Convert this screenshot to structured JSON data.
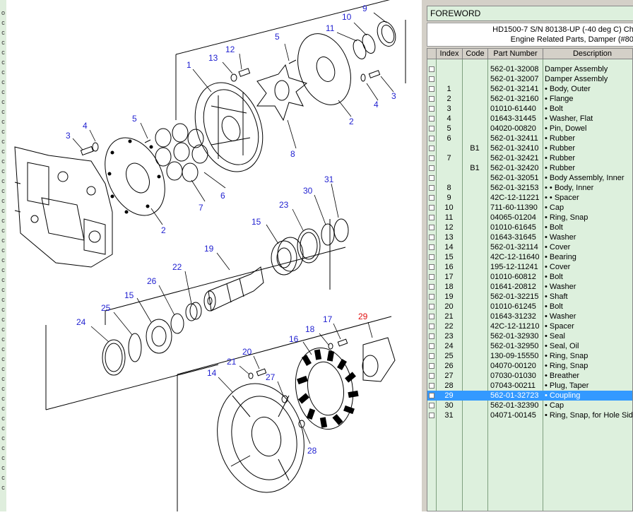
{
  "left_strip_letters": [
    "o",
    "c",
    "c",
    "c",
    "c",
    "c",
    "c",
    "c",
    "c",
    "c",
    "c",
    "c",
    "c",
    "c",
    "c",
    "c",
    "c",
    "c",
    "c",
    "c",
    "c",
    "c",
    "c",
    "c",
    "c",
    "c",
    "c",
    "c",
    "c",
    "c",
    "c",
    "c",
    "c",
    "c",
    "c",
    "c",
    "c",
    "c",
    "c",
    "c",
    "c",
    "c",
    "c",
    "c",
    "c",
    "c",
    "c",
    "c",
    "c"
  ],
  "doc_title": "FOREWORD",
  "header": {
    "line1": "HD1500-7 S/N 80138-UP (-40 deg C) Cha",
    "line2": "Engine Related Parts, Damper (#801"
  },
  "columns": {
    "index": "Index",
    "code": "Code",
    "part_number": "Part Number",
    "description": "Description"
  },
  "rows": [
    {
      "index": "",
      "code": "",
      "part": "562-01-32008",
      "desc": "Damper Assembly"
    },
    {
      "index": "",
      "code": "",
      "part": "562-01-32007",
      "desc": "Damper Assembly"
    },
    {
      "index": "1",
      "code": "",
      "part": "562-01-32141",
      "desc": "• Body, Outer"
    },
    {
      "index": "2",
      "code": "",
      "part": "562-01-32160",
      "desc": "• Flange"
    },
    {
      "index": "3",
      "code": "",
      "part": "01010-61440",
      "desc": "• Bolt"
    },
    {
      "index": "4",
      "code": "",
      "part": "01643-31445",
      "desc": "• Washer, Flat"
    },
    {
      "index": "5",
      "code": "",
      "part": "04020-00820",
      "desc": "• Pin, Dowel"
    },
    {
      "index": "6",
      "code": "",
      "part": "562-01-32411",
      "desc": "• Rubber"
    },
    {
      "index": "",
      "code": "B1",
      "part": "562-01-32410",
      "desc": "• Rubber"
    },
    {
      "index": "7",
      "code": "",
      "part": "562-01-32421",
      "desc": "• Rubber"
    },
    {
      "index": "",
      "code": "B1",
      "part": "562-01-32420",
      "desc": "• Rubber"
    },
    {
      "index": "",
      "code": "",
      "part": "562-01-32051",
      "desc": "• Body Assembly, Inner"
    },
    {
      "index": "8",
      "code": "",
      "part": "562-01-32153",
      "desc": "• • Body, Inner"
    },
    {
      "index": "9",
      "code": "",
      "part": "42C-12-11221",
      "desc": "• • Spacer"
    },
    {
      "index": "10",
      "code": "",
      "part": "711-60-11390",
      "desc": "• Cap"
    },
    {
      "index": "11",
      "code": "",
      "part": "04065-01204",
      "desc": "• Ring, Snap"
    },
    {
      "index": "12",
      "code": "",
      "part": "01010-61645",
      "desc": "• Bolt"
    },
    {
      "index": "13",
      "code": "",
      "part": "01643-31645",
      "desc": "• Washer"
    },
    {
      "index": "14",
      "code": "",
      "part": "562-01-32114",
      "desc": "• Cover"
    },
    {
      "index": "15",
      "code": "",
      "part": "42C-12-11640",
      "desc": "• Bearing"
    },
    {
      "index": "16",
      "code": "",
      "part": "195-12-11241",
      "desc": "• Cover"
    },
    {
      "index": "17",
      "code": "",
      "part": "01010-60812",
      "desc": "• Bolt"
    },
    {
      "index": "18",
      "code": "",
      "part": "01641-20812",
      "desc": "• Washer"
    },
    {
      "index": "19",
      "code": "",
      "part": "562-01-32215",
      "desc": "• Shaft"
    },
    {
      "index": "20",
      "code": "",
      "part": "01010-61245",
      "desc": "• Bolt"
    },
    {
      "index": "21",
      "code": "",
      "part": "01643-31232",
      "desc": "• Washer"
    },
    {
      "index": "22",
      "code": "",
      "part": "42C-12-11210",
      "desc": "• Spacer"
    },
    {
      "index": "23",
      "code": "",
      "part": "562-01-32930",
      "desc": "• Seal"
    },
    {
      "index": "24",
      "code": "",
      "part": "562-01-32950",
      "desc": "• Seal, Oil"
    },
    {
      "index": "25",
      "code": "",
      "part": "130-09-15550",
      "desc": "• Ring, Snap"
    },
    {
      "index": "26",
      "code": "",
      "part": "04070-00120",
      "desc": "• Ring, Snap"
    },
    {
      "index": "27",
      "code": "",
      "part": "07030-01030",
      "desc": "• Breather"
    },
    {
      "index": "28",
      "code": "",
      "part": "07043-00211",
      "desc": "• Plug, Taper"
    },
    {
      "index": "29",
      "code": "",
      "part": "562-01-32723",
      "desc": "• Coupling",
      "selected": true
    },
    {
      "index": "30",
      "code": "",
      "part": "562-01-32390",
      "desc": "• Cap"
    },
    {
      "index": "31",
      "code": "",
      "part": "04071-00145",
      "desc": "• Ring, Snap, for Hole Sid"
    }
  ],
  "callouts": {
    "c1": "1",
    "c2a": "2",
    "c2b": "2",
    "c3a": "3",
    "c3b": "3",
    "c4a": "4",
    "c4b": "4",
    "c5a": "5",
    "c5b": "5",
    "c6": "6",
    "c7": "7",
    "c8": "8",
    "c9": "9",
    "c10": "10",
    "c11": "11",
    "c12": "12",
    "c13": "13",
    "c14": "14",
    "c15a": "15",
    "c15b": "15",
    "c16": "16",
    "c17": "17",
    "c18": "18",
    "c19": "19",
    "c20": "20",
    "c21": "21",
    "c22": "22",
    "c23": "23",
    "c24": "24",
    "c25": "25",
    "c26": "26",
    "c27": "27",
    "c28": "28",
    "c29": "29",
    "c30": "30",
    "c31": "31"
  },
  "colors": {
    "callout": "#1f1fd0",
    "callout_selected": "#e01010",
    "grid_bg": "#ddf0dd",
    "selection": "#3399ff"
  }
}
